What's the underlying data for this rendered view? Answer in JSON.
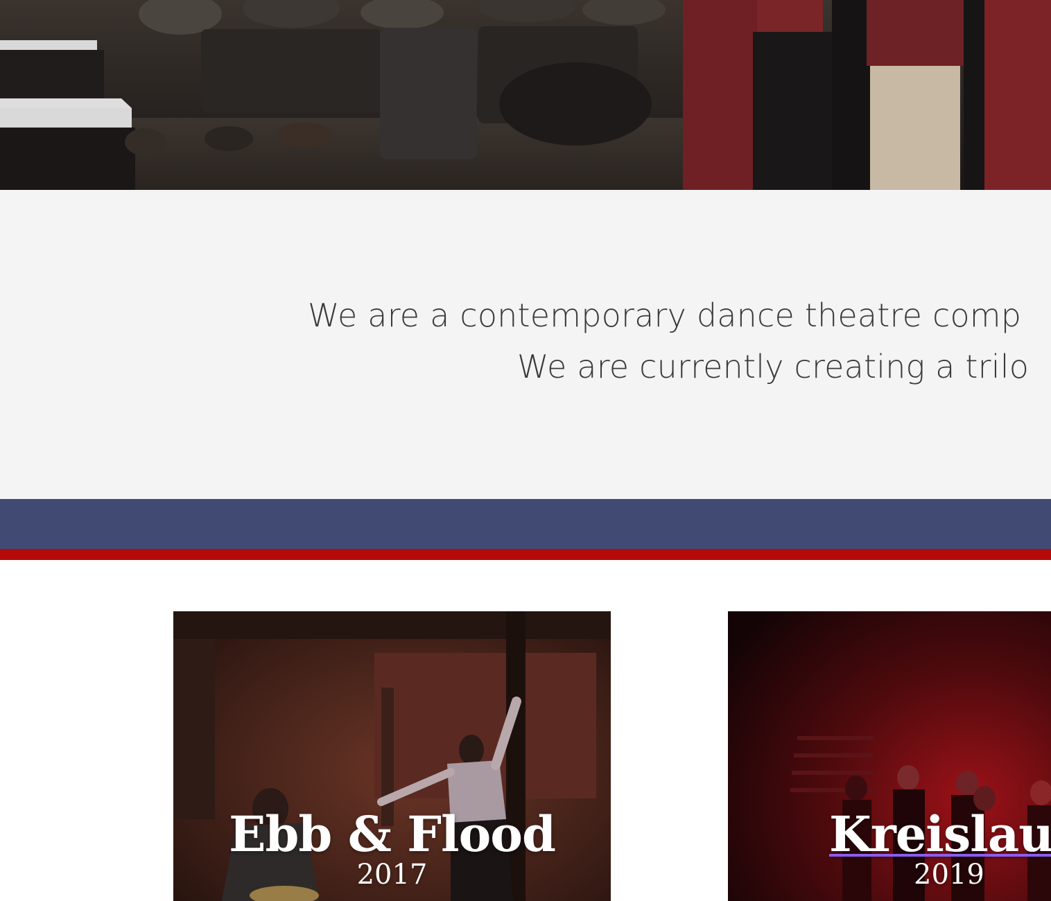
{
  "hero": {
    "photo": "performers-on-stage-photo"
  },
  "intro": {
    "line1": "We are a contemporary dance theatre comp",
    "line2": "We are currently creating a trilo"
  },
  "productions": [
    {
      "title": "Ebb & Flood",
      "year": "2017",
      "photo": "dancer-reaching-photo"
    },
    {
      "title": "Kreislauf",
      "year": "2019",
      "photo": "ensemble-red-light-photo"
    }
  ],
  "colors": {
    "intro_bg": "#f4f4f4",
    "band_blue": "#414a73",
    "band_red": "#b50a0a",
    "link_underline": "#8a5cf0"
  }
}
